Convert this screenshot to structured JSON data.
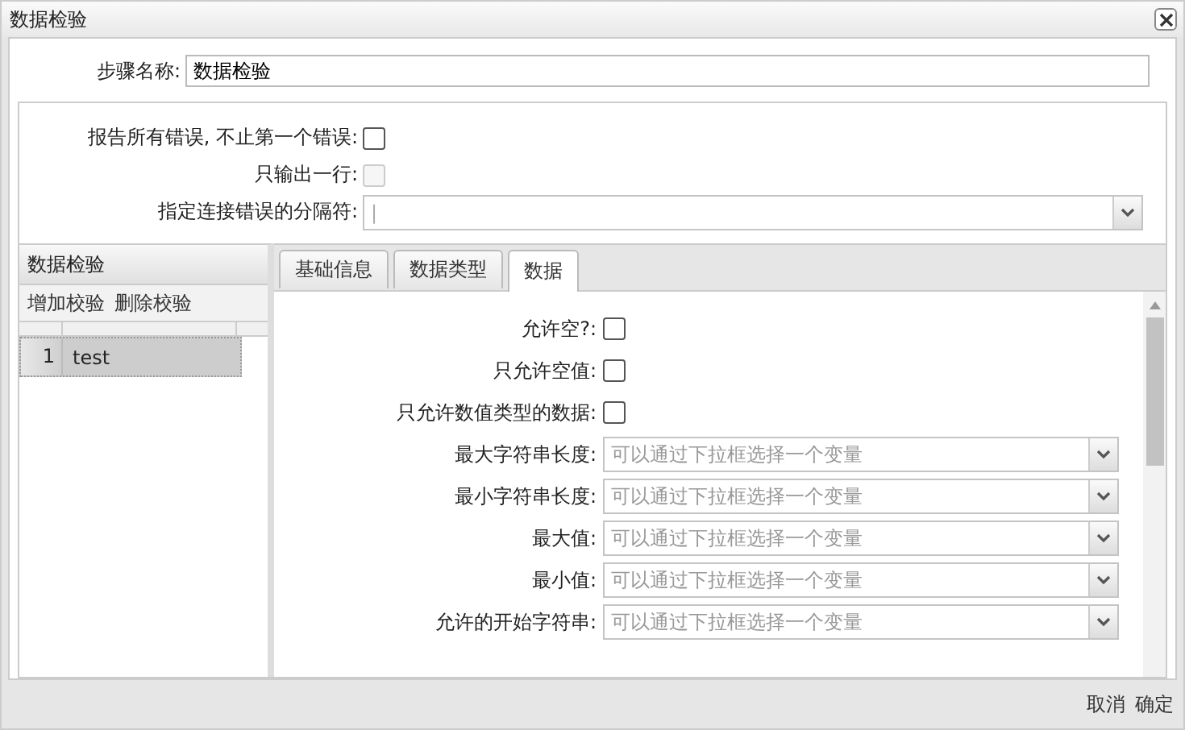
{
  "window": {
    "title": "数据检验"
  },
  "step_name": {
    "label": "步骤名称:",
    "value": "数据检验"
  },
  "options": [
    {
      "kind": "checkbox",
      "label": "报告所有错误, 不止第一个错误:",
      "checked": false,
      "disabled": false
    },
    {
      "kind": "checkbox",
      "label": "只输出一行:",
      "checked": false,
      "disabled": true
    },
    {
      "kind": "combo",
      "label": "指定连接错误的分隔符:",
      "value": "|"
    }
  ],
  "validations": {
    "title": "数据检验",
    "actions": [
      "增加校验",
      "删除校验"
    ],
    "rows": [
      {
        "number": "1",
        "name": "test",
        "selected": true
      }
    ]
  },
  "tabs": [
    {
      "label": "基础信息",
      "selected": false
    },
    {
      "label": "数据类型",
      "selected": false
    },
    {
      "label": "数据",
      "selected": true
    }
  ],
  "fields": [
    {
      "kind": "checkbox",
      "label": "允许空?:",
      "checked": false
    },
    {
      "kind": "checkbox",
      "label": "只允许空值:",
      "checked": false
    },
    {
      "kind": "checkbox",
      "label": "只允许数值类型的数据:",
      "checked": false
    },
    {
      "kind": "combo",
      "label": "最大字符串长度:",
      "placeholder": "可以通过下拉框选择一个变量"
    },
    {
      "kind": "combo",
      "label": "最小字符串长度:",
      "placeholder": "可以通过下拉框选择一个变量"
    },
    {
      "kind": "combo",
      "label": "最大值:",
      "placeholder": "可以通过下拉框选择一个变量"
    },
    {
      "kind": "combo",
      "label": "最小值:",
      "placeholder": "可以通过下拉框选择一个变量"
    },
    {
      "kind": "combo",
      "label": "允许的开始字符串:",
      "placeholder": "可以通过下拉框选择一个变量"
    }
  ],
  "buttons": [
    "取消",
    "确定"
  ]
}
